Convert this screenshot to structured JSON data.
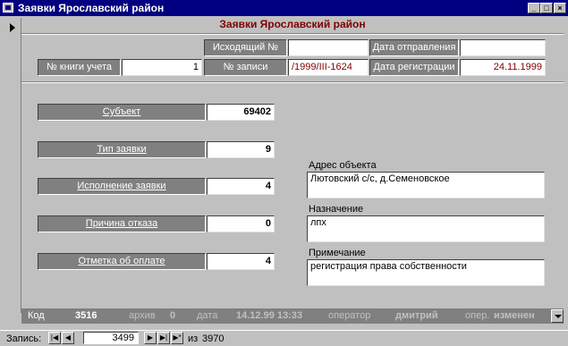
{
  "window": {
    "title": "Заявки Ярославский район"
  },
  "form": {
    "title": "Заявки Ярославский район",
    "outgoing_label": "Исходящий №",
    "outgoing_value": "",
    "sent_date_label": "Дата отправления",
    "sent_date_value": "",
    "book_label": "№ книги учета",
    "book_value": "1",
    "record_label": "№ записи",
    "record_value": "/1999/III-1624",
    "reg_date_label": "Дата регистрации",
    "reg_date_value": "24.11.1999",
    "subject_label": "Субъект",
    "subject_value": "69402",
    "type_label": "Тип заявки",
    "type_value": "9",
    "execution_label": "Исполнение заявки",
    "execution_value": "4",
    "refusal_label": "Причина отказа",
    "refusal_value": "0",
    "payment_label": "Отметка об оплате",
    "payment_value": "4",
    "address_label": "Адрес объекта",
    "address_value": "Лютовский с/с, д.Семеновское",
    "purpose_label": "Назначение",
    "purpose_value": "лпх",
    "note_label": "Примечание",
    "note_value": " регистрация права собственности"
  },
  "footer": {
    "code_label": "Код",
    "code_value": "3516",
    "archive_label": "архив",
    "archive_value": "0",
    "date_label": "дата",
    "date_value": "14.12.99 13:33",
    "operator_label": "оператор",
    "operator_value": "дмитрий",
    "op_label": "опер.",
    "op_value": "изменен"
  },
  "navigation": {
    "record_label": "Запись:",
    "current": "3499",
    "of_label": "из",
    "total": "3970",
    "first_icon": "first-record-icon",
    "prev_icon": "prev-record-icon",
    "next_icon": "next-record-icon",
    "last_icon": "last-record-icon",
    "new_icon": "new-record-icon"
  }
}
